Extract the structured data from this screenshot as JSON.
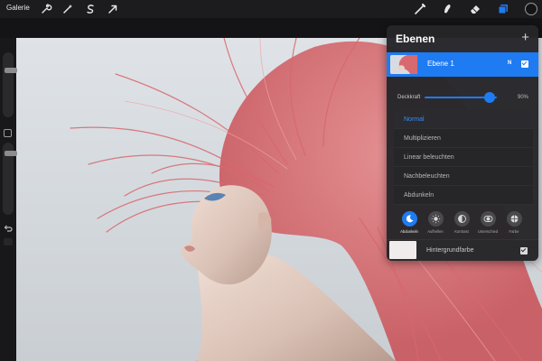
{
  "toolbar": {
    "gallery_label": "Galerie",
    "left_tools": [
      "wrench-icon",
      "magic-wand-icon",
      "selection-icon",
      "transform-arrow-icon"
    ],
    "right_tools": [
      "brush-icon",
      "smudge-icon",
      "eraser-icon",
      "layers-icon",
      "color-picker-icon"
    ],
    "active_color": "#141414",
    "accent_color": "#1f7bf2"
  },
  "layers": {
    "title": "Ebenen",
    "add_label": "+",
    "layer": {
      "name": "Ebene 1",
      "blend_badge": "N",
      "visible": true
    },
    "opacity": {
      "label": "Deckkraft",
      "value": "90%",
      "fraction": 0.9
    },
    "blend_modes": [
      {
        "label": "Normal",
        "selected": true
      },
      {
        "label": "Multiplizieren",
        "selected": false
      },
      {
        "label": "Linear beleuchten",
        "selected": false
      },
      {
        "label": "Nachbeleuchten",
        "selected": false
      },
      {
        "label": "Abdunkeln",
        "selected": false
      }
    ],
    "blend_categories": [
      {
        "label": "Abdunkeln",
        "icon": "moon-icon",
        "active": true
      },
      {
        "label": "Aufhellen",
        "icon": "sun-icon",
        "active": false
      },
      {
        "label": "Kontrast",
        "icon": "contrast-icon",
        "active": false
      },
      {
        "label": "Unterschied",
        "icon": "difference-icon",
        "active": false
      },
      {
        "label": "Farbe",
        "icon": "color-icon",
        "active": false
      }
    ],
    "background": {
      "label": "Hintergrundfarbe",
      "color": "#efeceb",
      "visible": true
    }
  }
}
